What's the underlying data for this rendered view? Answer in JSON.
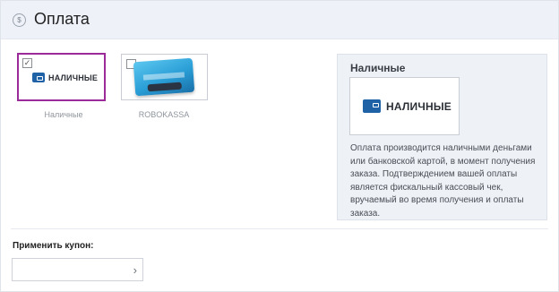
{
  "header": {
    "title": "Оплата",
    "coin_icon": "coin-icon"
  },
  "payment_options": [
    {
      "id": "cash",
      "logo_text": "НАЛИЧНЫЕ",
      "caption": "Наличные",
      "checked": true
    },
    {
      "id": "robokassa",
      "caption": "ROBOKASSA",
      "checked": false
    }
  ],
  "details": {
    "title": "Наличные",
    "logo_text": "НАЛИЧНЫЕ",
    "description": "Оплата производится наличными деньгами или банковской картой, в момент получения заказа. Подтверждением вашей оплаты является фискальный кассовый чек, вручаемый во время получения и оплаты заказа."
  },
  "coupon": {
    "label": "Применить купон:",
    "placeholder": "",
    "value": ""
  },
  "colors": {
    "selected_border": "#9c2b9a",
    "wallet_blue": "#1f63a6",
    "header_bg": "#eef1f8"
  }
}
